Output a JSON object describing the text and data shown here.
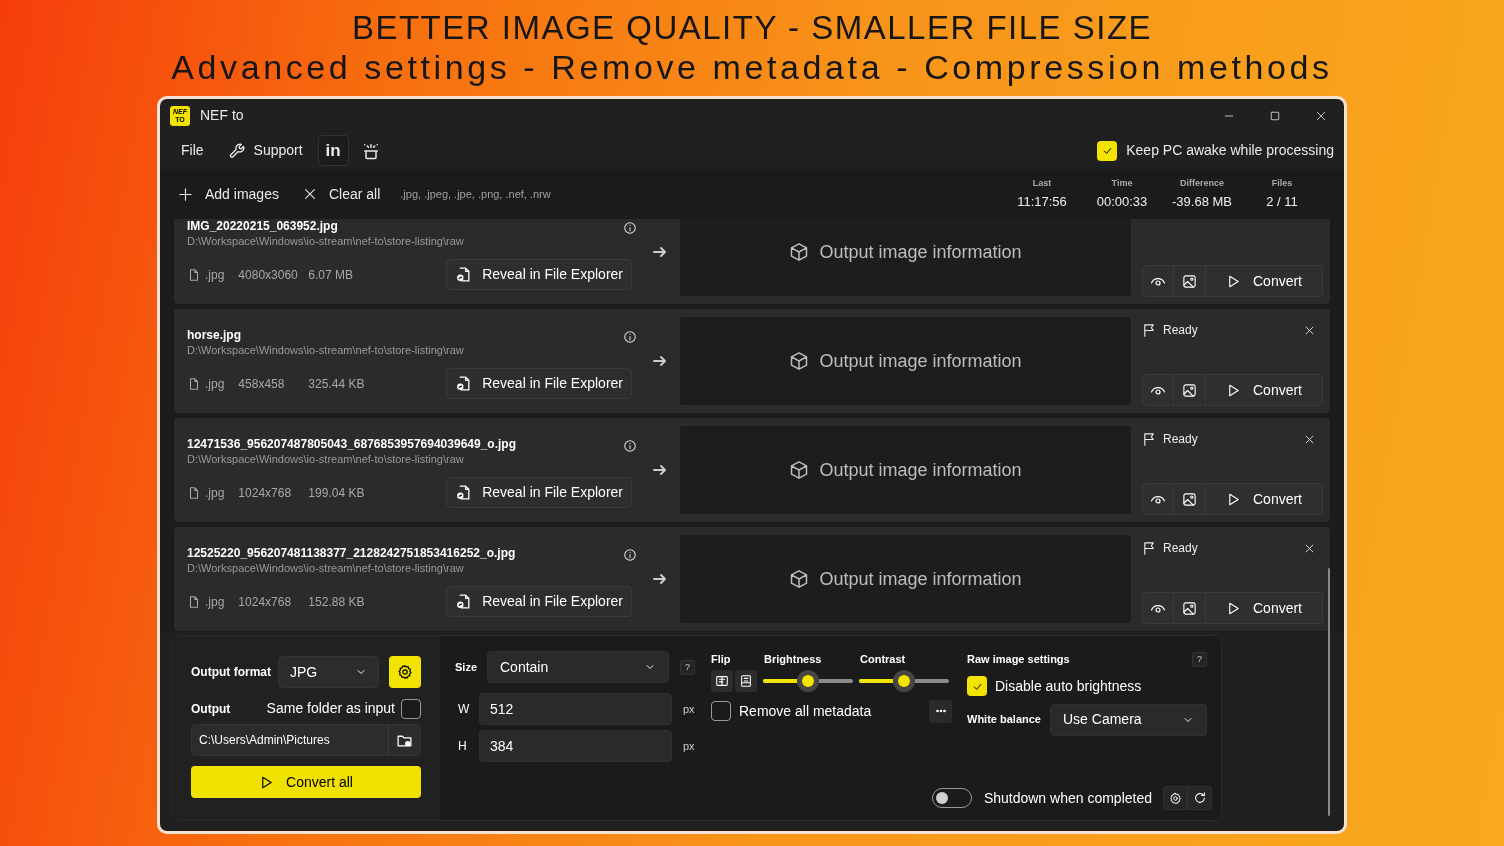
{
  "banner": {
    "line_1": "BETTER IMAGE QUALITY - SMALLER FILE SIZE",
    "line_2": "Advanced settings - Remove metadata - Compression methods"
  },
  "window": {
    "title": "NEF to",
    "logo_top": "NEF",
    "logo_bottom": "TO"
  },
  "menu": [
    {
      "kind": "text",
      "label": "File"
    },
    {
      "kind": "wrench",
      "label": "Support"
    },
    {
      "kind": "badge",
      "label": "in"
    },
    {
      "kind": "sparkle"
    }
  ],
  "keep_awake": {
    "label": "Keep PC awake while processing",
    "checked": true
  },
  "toolbar": {
    "add": "Add images",
    "clear": "Clear all",
    "formats": ".jpg, .jpeg, .jpe, .png, .nef, .nrw"
  },
  "stats": [
    {
      "label": "Last",
      "value": "11:17:56"
    },
    {
      "label": "Time",
      "value": "00:00:33"
    },
    {
      "label": "Difference",
      "value": "-39.68 MB"
    },
    {
      "label": "Files",
      "value": "2 / 11"
    }
  ],
  "files": [
    {
      "name": "IMG_20220215_063952.jpg",
      "path": "D:\\Workspace\\Windows\\io-stream\\nef-to\\store-listing\\raw",
      "ext": ".jpg",
      "dimensions": "4080x3060",
      "size": "6.07 MB",
      "reveal": "Reveal in File Explorer",
      "output": "Output image information",
      "convert": "Convert"
    },
    {
      "name": "horse.jpg",
      "path": "D:\\Workspace\\Windows\\io-stream\\nef-to\\store-listing\\raw",
      "ext": ".jpg",
      "dimensions": "458x458",
      "size": "325.44 KB",
      "reveal": "Reveal in File Explorer",
      "output": "Output image information",
      "status": "Ready",
      "convert": "Convert"
    },
    {
      "name": "12471536_956207487805043_6876853957694039649_o.jpg",
      "path": "D:\\Workspace\\Windows\\io-stream\\nef-to\\store-listing\\raw",
      "ext": ".jpg",
      "dimensions": "1024x768",
      "size": "199.04 KB",
      "reveal": "Reveal in File Explorer",
      "output": "Output image information",
      "status": "Ready",
      "convert": "Convert"
    },
    {
      "name": "12525220_956207481138377_2128242751853416252_o.jpg",
      "path": "D:\\Workspace\\Windows\\io-stream\\nef-to\\store-listing\\raw",
      "ext": ".jpg",
      "dimensions": "1024x768",
      "size": "152.88 KB",
      "reveal": "Reveal in File Explorer",
      "output": "Output image information",
      "status": "Ready",
      "convert": "Convert"
    }
  ],
  "settings": {
    "output_format": {
      "label": "Output format",
      "value": "JPG"
    },
    "output": {
      "label": "Output",
      "same_folder": {
        "label": "Same folder as input",
        "checked": false
      },
      "path": "C:\\Users\\Admin\\Pictures"
    },
    "convert_all": "Convert all",
    "size": {
      "label": "Size",
      "mode": "Contain",
      "help": "?",
      "width": {
        "label": "W",
        "value": "512",
        "unit": "px"
      },
      "height": {
        "label": "H",
        "value": "384",
        "unit": "px"
      }
    },
    "flip": {
      "label": "Flip"
    },
    "brightness": {
      "label": "Brightness",
      "level": 0.5
    },
    "contrast": {
      "label": "Contrast",
      "level": 0.5
    },
    "remove_metadata": {
      "label": "Remove all metadata",
      "checked": false
    },
    "raw": {
      "title": "Raw image settings",
      "help": "?",
      "disable_auto_brightness": {
        "label": "Disable auto brightness",
        "checked": true
      },
      "white_balance": {
        "label": "White balance",
        "value": "Use Camera"
      }
    },
    "shutdown": {
      "label": "Shutdown when completed",
      "on": false
    }
  }
}
